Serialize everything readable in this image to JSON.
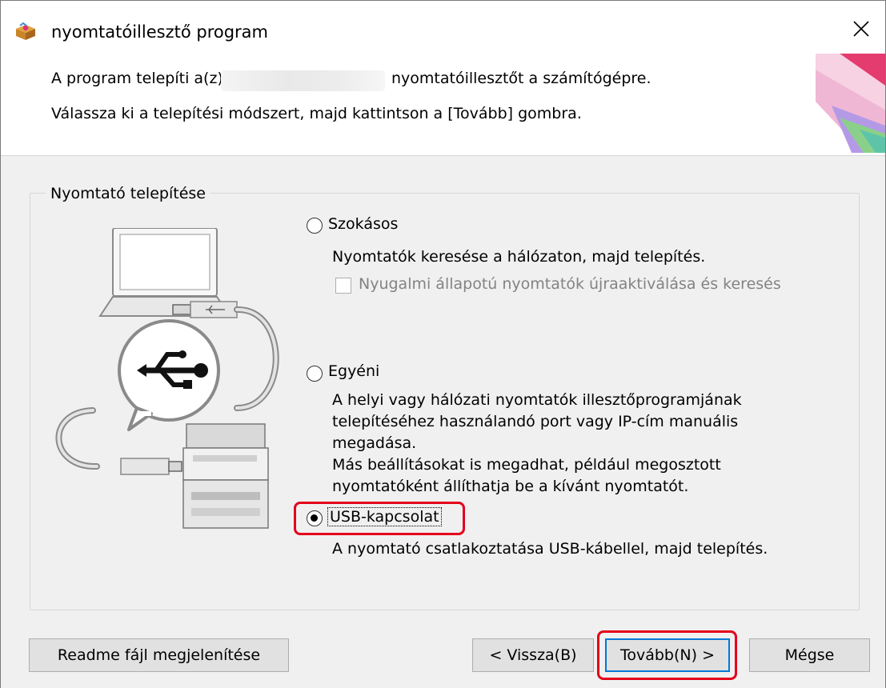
{
  "window": {
    "title": "nyomtatóillesztő program"
  },
  "header": {
    "line1_before": "A program telepíti a(z)",
    "line1_after": "nyomtatóillesztőt a számítógépre.",
    "line2": "Válassza ki a telepítési módszert, majd kattintson a [Tovább] gombra."
  },
  "group": {
    "label": "Nyomtató telepítése"
  },
  "options": {
    "standard": {
      "label": "Szokásos",
      "description": "Nyomtatók keresése a hálózaton, majd telepítés.",
      "checkbox_label": "Nyugalmi állapotú nyomtatók újraaktiválása és keresés"
    },
    "custom": {
      "label": "Egyéni",
      "description": [
        "A helyi vagy hálózati nyomtatók illesztőprogramjának",
        "telepítéséhez használandó port vagy IP-cím manuális",
        "megadása.",
        "Más beállításokat is megadhat, például megosztott",
        "nyomtatóként állíthatja be a kívánt nyomtatót."
      ]
    },
    "usb": {
      "label": "USB-kapcsolat",
      "description": "A nyomtató csatlakoztatása USB-kábellel, majd telepítés.",
      "selected": true
    }
  },
  "buttons": {
    "readme": "Readme fájl megjelenítése",
    "back": "< Vissza(B)",
    "next": "Tovább(N) >",
    "cancel": "Mégse"
  },
  "colors": {
    "highlight": "#e3001b",
    "default_button_border": "#0078d7",
    "dialog_body": "#f0f0f0"
  }
}
